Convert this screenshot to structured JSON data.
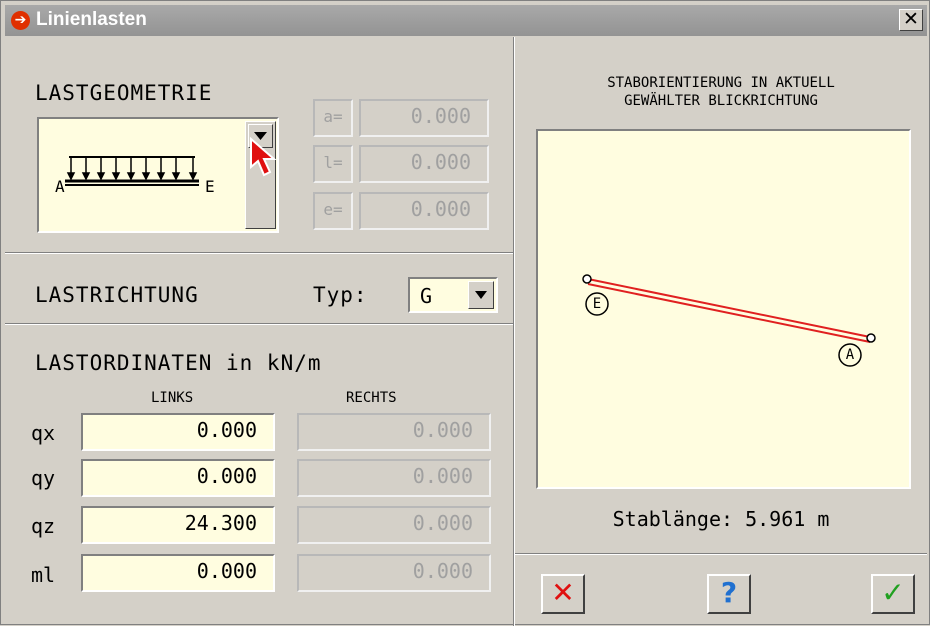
{
  "window": {
    "title": "Linienlasten",
    "close_glyph": "✕"
  },
  "geometry": {
    "heading": "LASTGEOMETRIE",
    "label_a": "A",
    "label_e": "E",
    "fields": [
      {
        "prefix": "a=",
        "value": "0.000"
      },
      {
        "prefix": "l=",
        "value": "0.000"
      },
      {
        "prefix": "e=",
        "value": "0.000"
      }
    ]
  },
  "direction": {
    "heading": "LASTRICHTUNG",
    "typ_label": "Typ:",
    "typ_value": "G"
  },
  "ordinates": {
    "heading": "LASTORDINATEN in kN/m",
    "col_left": "LINKS",
    "col_right": "RECHTS",
    "rows": [
      {
        "label": "qx",
        "left": "0.000",
        "right": "0.000"
      },
      {
        "label": "qy",
        "left": "0.000",
        "right": "0.000"
      },
      {
        "label": "qz",
        "left": "24.300",
        "right": "0.000"
      },
      {
        "label": "ml",
        "left": "0.000",
        "right": "0.000"
      }
    ]
  },
  "preview": {
    "heading_line1": "STABORIENTIERUNG IN AKTUELL",
    "heading_line2": "GEWÄHLTER BLICKRICHTUNG",
    "node_start": "A",
    "node_end": "E",
    "length_text": "Stablänge: 5.961 m"
  },
  "buttons": {
    "cancel_glyph": "✕",
    "help_glyph": "?",
    "ok_glyph": "✓"
  },
  "colors": {
    "field_bg": "#fffde0",
    "member_line": "#e02020",
    "cancel": "#e01010",
    "ok": "#20a020",
    "help": "#2070d0"
  }
}
